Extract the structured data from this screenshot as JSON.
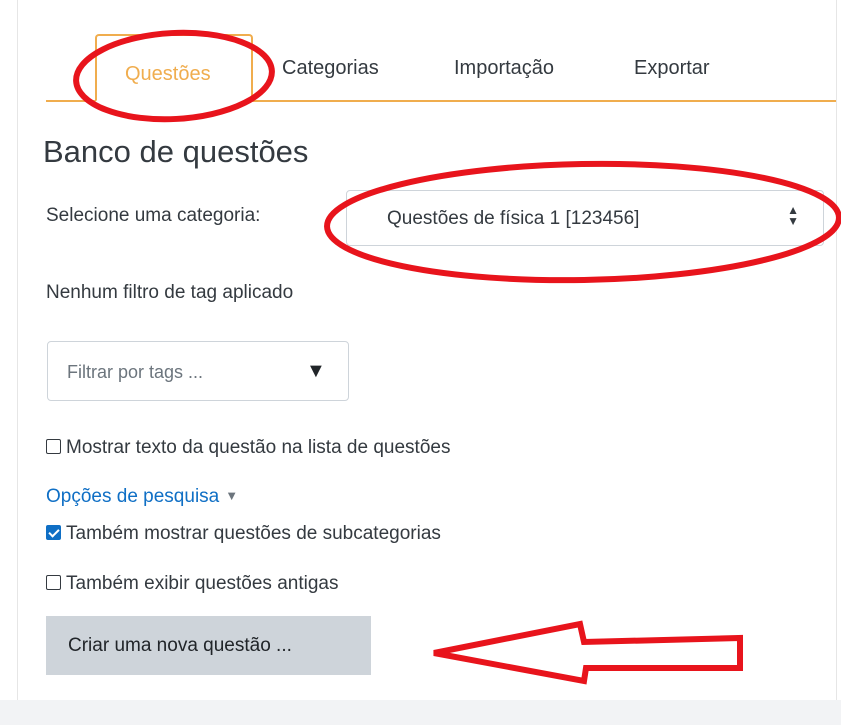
{
  "tabs": [
    {
      "label": "Questões",
      "active": true
    },
    {
      "label": "Categorias",
      "active": false
    },
    {
      "label": "Importação",
      "active": false
    },
    {
      "label": "Exportar",
      "active": false
    }
  ],
  "page_title": "Banco de questões",
  "category_select": {
    "label": "Selecione uma categoria:",
    "value": "Questões de física 1 [123456]"
  },
  "tag_status": "Nenhum filtro de tag aplicado",
  "tag_filter": {
    "placeholder": "Filtrar por tags ..."
  },
  "show_question_text": {
    "label": "Mostrar texto da questão na lista de questões",
    "checked": false
  },
  "search_options": {
    "label": "Opções de pesquisa"
  },
  "show_subcategories": {
    "label": "Também mostrar questões de subcategorias",
    "checked": true
  },
  "show_old_questions": {
    "label": "Também exibir questões antigas",
    "checked": false
  },
  "create_button": {
    "label": "Criar uma nova questão ..."
  },
  "colors": {
    "accent": "#f0ad4e",
    "link": "#0f6fc5",
    "button_bg": "#ced4da",
    "annotation": "#e8141c"
  }
}
